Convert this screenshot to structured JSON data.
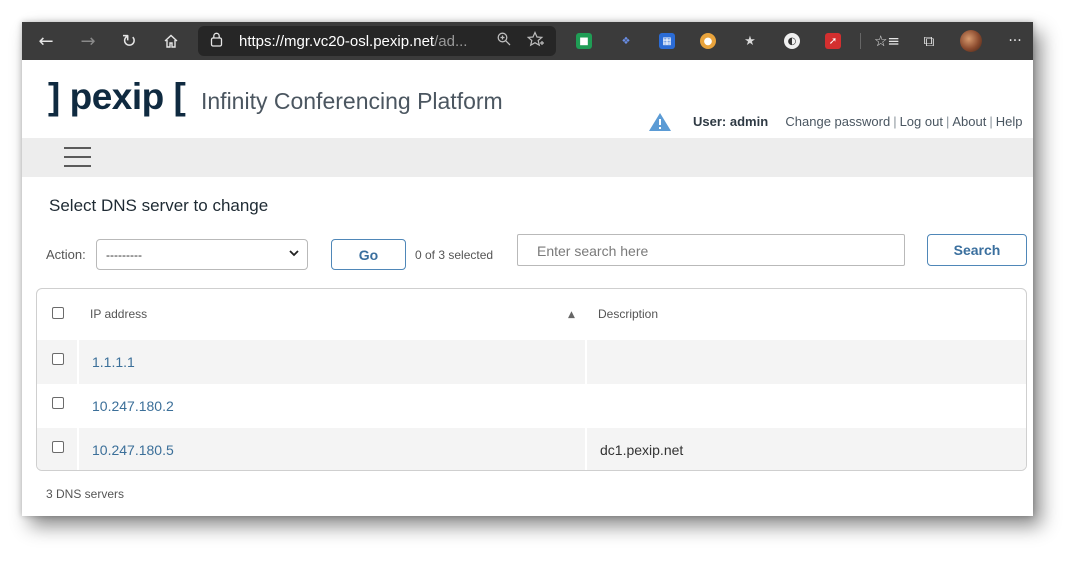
{
  "browser": {
    "url_main": "https://mgr.vc20-osl.pexip.net",
    "url_rest": "/ad...",
    "icons": {
      "back": "back-arrow-icon",
      "forward": "forward-arrow-icon",
      "refresh": "refresh-icon",
      "home": "home-icon",
      "lock": "lock-icon",
      "zoom": "zoom-icon",
      "favorite": "add-favorite-icon",
      "favorites": "favorites-icon",
      "collections": "collections-icon",
      "more": "more-icon"
    },
    "extension_colors": [
      "#1f9d55",
      "#2a5bd7",
      "#2b6cd6",
      "#e8a33c",
      "#d9d9d9",
      "#f0f0f0",
      "#d32f2f"
    ],
    "more_label": "···"
  },
  "header": {
    "logo_text": "] pexip [",
    "product_name": "Infinity Conferencing Platform",
    "user_label": "User: admin",
    "links": [
      "Change password",
      "Log out",
      "About",
      "Help"
    ],
    "separator": "|"
  },
  "page": {
    "title": "Select DNS server to change",
    "action_label": "Action:",
    "action_value": "---------",
    "go_label": "Go",
    "selected_count": "0 of 3 selected",
    "search_placeholder": "Enter search here",
    "search_label": "Search"
  },
  "table": {
    "columns": [
      "IP address",
      "Description"
    ],
    "rows": [
      {
        "ip": "1.1.1.1",
        "description": ""
      },
      {
        "ip": "10.247.180.2",
        "description": ""
      },
      {
        "ip": "10.247.180.5",
        "description": "dc1.pexip.net"
      }
    ]
  },
  "footer": {
    "count_text": "3 DNS servers"
  },
  "colors": {
    "toolbar_bg": "#3b3b3b",
    "brand_dark": "#0f2a40",
    "link_blue": "#3b6f99",
    "button_border": "#4f87b8",
    "warning_blue": "#5b9bd5"
  }
}
